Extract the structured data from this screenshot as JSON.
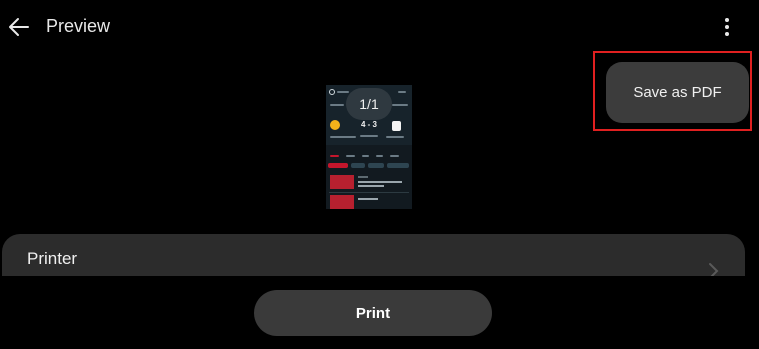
{
  "header": {
    "title": "Preview"
  },
  "menu": {
    "save_as_pdf_label": "Save as PDF"
  },
  "preview": {
    "page_indicator": "1/1",
    "thumbnail_score": "4 - 3"
  },
  "printer": {
    "label": "Printer"
  },
  "actions": {
    "print_label": "Print"
  },
  "colors": {
    "background": "#000000",
    "card": "#2c2c2c",
    "button": "#3a3a3a",
    "highlight": "#e02020",
    "accent_red": "#c4162c"
  },
  "icons": {
    "back": "arrow-left-icon",
    "more": "more-vertical-icon",
    "chevron": "chevron-right-icon"
  }
}
